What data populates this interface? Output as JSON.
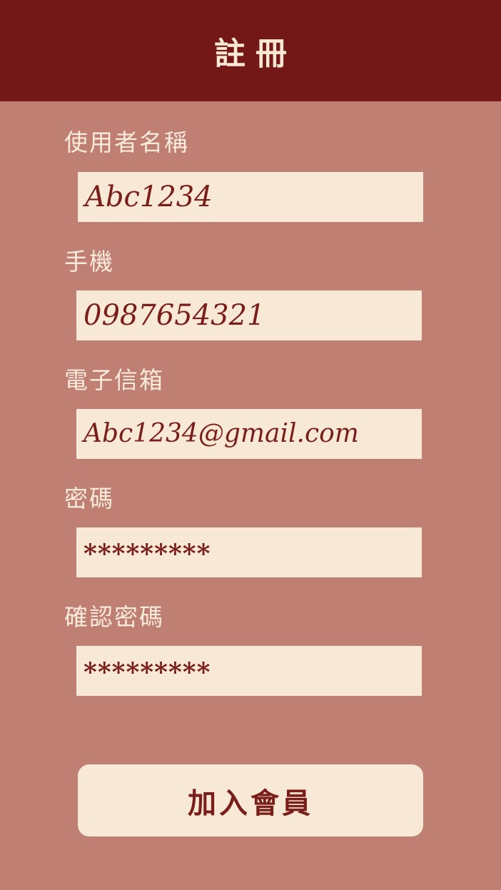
{
  "header": {
    "title": "註冊"
  },
  "form": {
    "username": {
      "label": "使用者名稱",
      "value": "Abc1234"
    },
    "phone": {
      "label": "手機",
      "value": "0987654321"
    },
    "email": {
      "label": "電子信箱",
      "value": "Abc1234@gmail.com"
    },
    "password": {
      "label": "密碼",
      "value": "*********"
    },
    "confirm_password": {
      "label": "確認密碼",
      "value": "*********"
    },
    "submit_label": "加入會員"
  },
  "colors": {
    "header_bg": "#731816",
    "page_bg": "#C07F73",
    "field_bg": "#F8E9D7",
    "accent_text": "#7A1E1B"
  }
}
